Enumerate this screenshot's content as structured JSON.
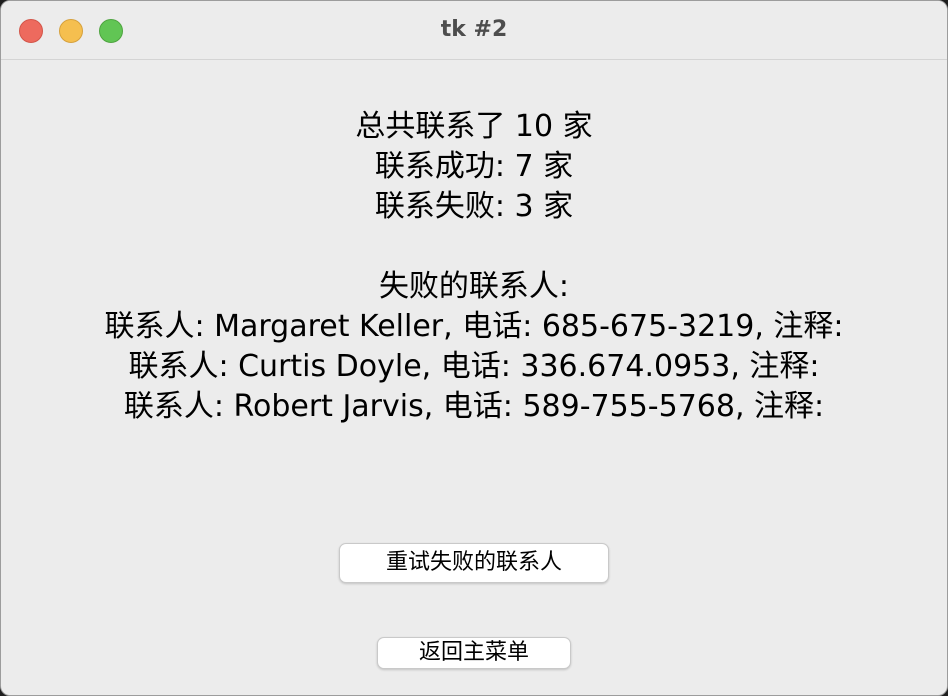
{
  "window": {
    "title": "tk #2"
  },
  "summary": {
    "total": "总共联系了 10 家",
    "success": "联系成功: 7 家",
    "failed": "联系失败: 3 家"
  },
  "failed_section": {
    "heading": "失败的联系人:",
    "contacts": [
      "联系人: Margaret Keller, 电话: 685-675-3219, 注释:",
      "联系人: Curtis Doyle, 电话: 336.674.0953, 注释:",
      "联系人: Robert Jarvis, 电话: 589-755-5768, 注释:"
    ]
  },
  "buttons": {
    "retry_label": "重试失败的联系人",
    "back_label": "返回主菜单"
  }
}
